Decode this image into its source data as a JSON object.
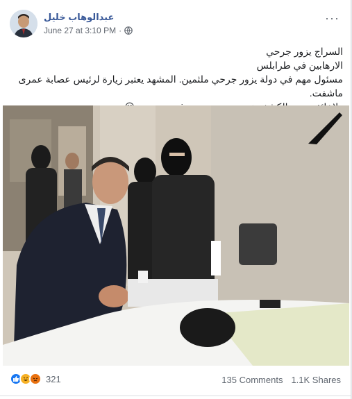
{
  "post": {
    "author": "عبدالوهاب خليل",
    "timestamp": "June 27 at 3:10 PM",
    "separator": "·",
    "more": "···",
    "text_lines": [
      "السراج يزور جرحي",
      "الارهابين في طرابلس",
      "مسئول مهم في دولة يزور جرحي ملثمين. المشهد يعتبر زيارة لرئيس عصابة عمرى ماشفت.",
      "ولاخائفين من الكشف عن وجوههم وتتعرف جنسيتهم 😀"
    ]
  },
  "reactions": {
    "count": "321",
    "icons": [
      "like-icon",
      "haha-icon",
      "angry-icon"
    ]
  },
  "stats": {
    "comments": "135 Comments",
    "shares": "1.1K Shares"
  },
  "colors": {
    "author": "#385898",
    "meta": "#616770",
    "like": "#1877f2",
    "haha": "#f7b125",
    "angry": "#e9710f"
  }
}
